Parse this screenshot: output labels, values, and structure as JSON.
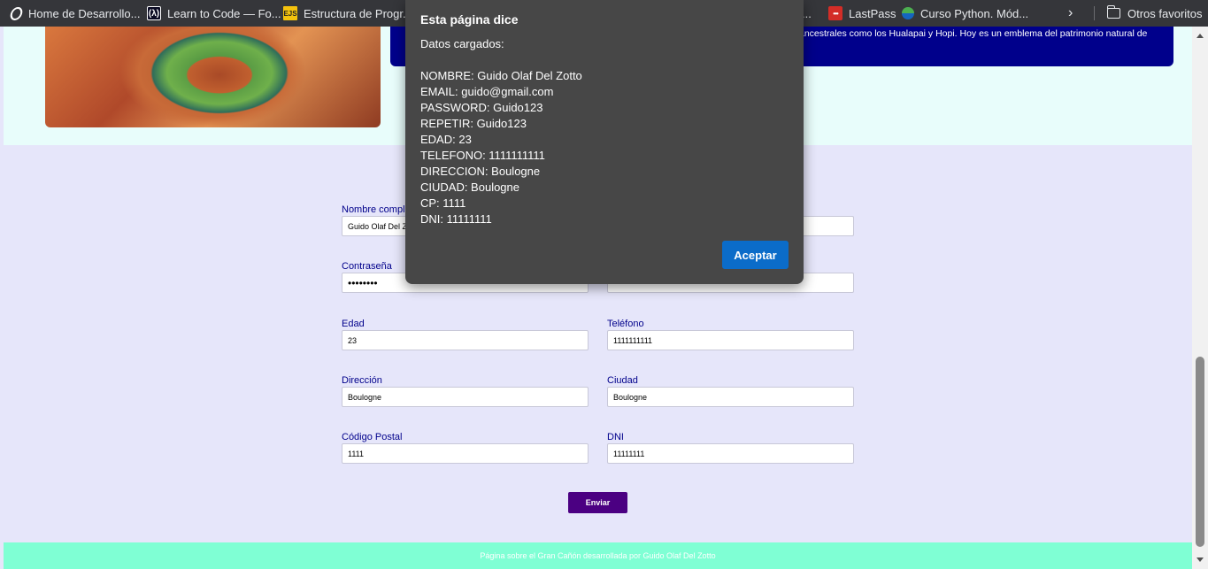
{
  "bookmarks": [
    {
      "label": "Home de Desarrollo...",
      "icon": "circle-logo-icon"
    },
    {
      "label": "Learn to Code — Fo...",
      "icon": "freecodecamp-icon"
    },
    {
      "label": "Estructura de Progr...",
      "icon": "ejs-icon"
    },
    {
      "label": "...",
      "icon": ""
    },
    {
      "label": "LastPass",
      "icon": "lastpass-icon"
    },
    {
      "label": "Curso Python. Mód...",
      "icon": "python-icon"
    },
    {
      "label": "Otros favoritos",
      "icon": "folder-icon"
    }
  ],
  "hero": {
    "info_text": "ancestrales como los Hualapai y Hopi. Hoy es un emblema del patrimonio natural de"
  },
  "form": {
    "fields": [
      {
        "label": "Nombre completo",
        "value": "Guido Olaf Del Zotto"
      },
      {
        "label": "",
        "value": ""
      },
      {
        "label": "Contraseña",
        "value": "••••••••"
      },
      {
        "label": "",
        "value": ""
      },
      {
        "label": "Edad",
        "value": "23"
      },
      {
        "label": "Teléfono",
        "value": "1111111111"
      },
      {
        "label": "Dirección",
        "value": "Boulogne"
      },
      {
        "label": "Ciudad",
        "value": "Boulogne"
      },
      {
        "label": "Código Postal",
        "value": "1111"
      },
      {
        "label": "DNI",
        "value": "11111111"
      }
    ],
    "submit_label": "Enviar"
  },
  "footer": {
    "text": "Página sobre el Gran Cañón desarrollada por Guido Olaf Del Zotto"
  },
  "dialog": {
    "title": "Esta página dice",
    "lines": [
      "Datos cargados:",
      "",
      "NOMBRE: Guido Olaf Del Zotto",
      "EMAIL: guido@gmail.com",
      "PASSWORD: Guido123",
      "REPETIR: Guido123",
      "EDAD: 23",
      "TELEFONO: 1111111111",
      "DIRECCION: Boulogne",
      "CIUDAD: Boulogne",
      "CP: 1111",
      "DNI: 11111111"
    ],
    "accept_label": "Aceptar"
  },
  "colors": {
    "dialog_bg": "#474747",
    "accept_button": "#0b6cc9",
    "info_box": "#00008b",
    "submit_button": "#4b0082",
    "footer": "#7fffd4"
  }
}
